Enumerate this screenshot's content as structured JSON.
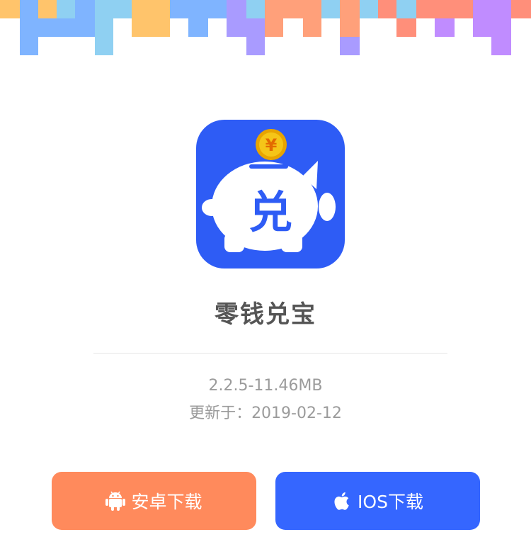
{
  "app": {
    "name": "零钱兑宝",
    "icon_glyph": "兑",
    "coin_symbol": "¥",
    "version_line": "2.2.5-11.46MB",
    "updated_line": "更新于：2019-02-12"
  },
  "buttons": {
    "android_label": "安卓下载",
    "ios_label": "IOS下载"
  },
  "icons": {
    "android": "android-icon",
    "apple": "apple-icon"
  },
  "colors": {
    "app_icon_bg": "#2e5cf5",
    "coin": "#f5c518",
    "android_button": "#ff8a5c",
    "ios_button": "#3566ff",
    "title_text": "#555555",
    "meta_text": "#9b9b9b",
    "banner": [
      "#7fb4ff",
      "#8fd0f2",
      "#ffc46b",
      "#a99bff",
      "#ffa07a",
      "#ff8f7a",
      "#c08cff"
    ]
  }
}
